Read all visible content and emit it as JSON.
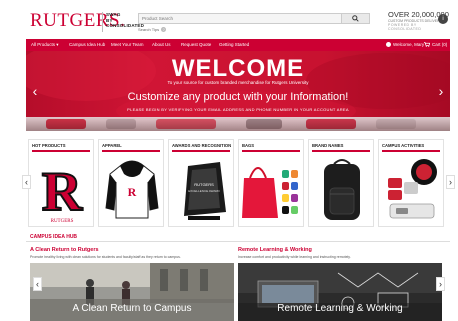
{
  "header": {
    "logo": "RUTGERS.",
    "swag_lines": [
      "SWAG",
      "BY",
      "CONSOLIDATED"
    ],
    "search_placeholder": "Product Search",
    "search_tips": "Search Tips",
    "promo_big": "OVER 20,000,000",
    "promo_small": "CUSTOM PRODUCTS DELIVERED",
    "promo_by": "POWERED BY CONSOLIDATED",
    "promo_badge": "i"
  },
  "nav": {
    "items": [
      "All Products ▾",
      "Campus Idea Hub",
      "Meet Your Team",
      "About Us",
      "Request Quote",
      "Getting Started"
    ],
    "user": "Welcome, Mary",
    "cart": "Cart (0)"
  },
  "hero": {
    "title": "WELCOME",
    "subtitle": "To your source for custom branded merchandise for Rutgers University",
    "main": "Customize any product with your Information!",
    "note": "PLEASE BEGIN BY VERIFYING YOUR EMAIL ADDRESS AND PHONE NUMBER IN YOUR ACCOUNT AREA",
    "prev": "‹",
    "next": "›"
  },
  "categories": [
    {
      "title": "HOT PRODUCTS"
    },
    {
      "title": "APPAREL"
    },
    {
      "title": "AWARDS AND RECOGNITION"
    },
    {
      "title": "BAGS"
    },
    {
      "title": "BRAND NAMES"
    },
    {
      "title": "CAMPUS ACTIVITIES"
    }
  ],
  "category_nav": {
    "prev": "‹",
    "next": "›"
  },
  "product_text": {
    "rutgers_letter": "R",
    "rutgers_word": "RUTGERS",
    "award_text": "RUTGERS",
    "award_sub": "EXCELLENCE AWARD"
  },
  "hub": {
    "title": "CAMPUS IDEA HUB",
    "cards": [
      {
        "title": "A Clean Return to Rutgers",
        "desc": "Promote healthy living with clean solutions for students and faculty/staff as they return to campus.",
        "caption": "A Clean Return to Campus"
      },
      {
        "title": "Remote Learning & Working",
        "desc": "Increase comfort and productivity while learning and instructing remotely.",
        "caption": "Remote Learning & Working"
      }
    ],
    "prev": "‹",
    "next": "›"
  },
  "colors": {
    "brand": "#cc0033",
    "white": "#ffffff"
  }
}
